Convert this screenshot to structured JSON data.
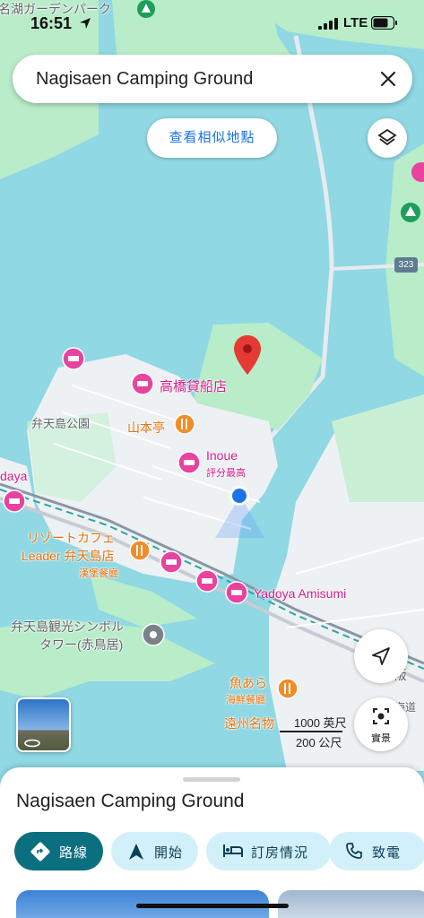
{
  "status_bar": {
    "time": "16:51",
    "network": "LTE"
  },
  "search": {
    "query": "Nagisaen Camping Ground"
  },
  "map": {
    "similar_places_button": "查看相似地點",
    "road_shield": "323",
    "top_label": "名湖ガーデンパーク",
    "labels": {
      "takahashi": "高橋貸船店",
      "park": "弁天島公園",
      "yamamoto": "山本亭",
      "inoue": "Inoue",
      "inoue_sub": "評分最高",
      "daya": "daya",
      "resort_cafe_1": "リゾートカフェ",
      "resort_cafe_2": "Leader 弁天島店",
      "resort_cafe_sub": "漢堡餐廳",
      "yadoya": "Yadoya Amisumi",
      "symbol_tower_1": "弁天島観光シンボル",
      "symbol_tower_2": "タワー(赤鳥居)",
      "uoara": "魚あら",
      "uoara_sub": "海鮮餐廳",
      "enshu": "遠州名物",
      "maisaka": "舞阪",
      "kaido": "海道"
    },
    "scale": {
      "imperial": "1000 英尺",
      "metric": "200 公尺"
    },
    "lens_label": "實景"
  },
  "sheet": {
    "place_name": "Nagisaen Camping Ground",
    "actions": [
      {
        "label": "路線",
        "icon": "directions-icon"
      },
      {
        "label": "開始",
        "icon": "navigation-arrow-icon"
      },
      {
        "label": "訂房情況",
        "icon": "bed-icon"
      },
      {
        "label": "致電",
        "icon": "phone-icon"
      }
    ]
  },
  "colors": {
    "water": "#8fd8e4",
    "land": "#b9ecc8",
    "urban": "#eef1f3",
    "pink_poi": "#e8439e",
    "orange_poi": "#f28c28",
    "accent": "#0b6f80",
    "chip_bg": "#d2f0fa"
  }
}
